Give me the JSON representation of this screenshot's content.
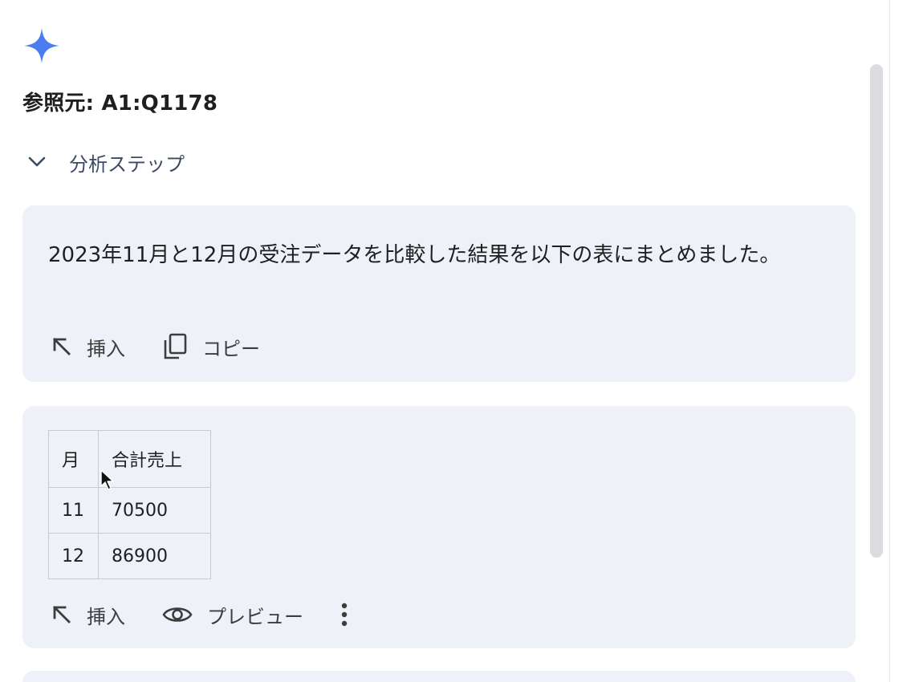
{
  "header": {
    "spark_icon": "gemini-spark-icon",
    "spark_color": "#4b7cf0",
    "source_label": "参照元: A1:Q1178"
  },
  "analysis_steps": {
    "label": "分析ステップ",
    "icon": "chevron-down-icon"
  },
  "summary_card": {
    "text": "2023年11月と12月の受注データを比較した結果を以下の表にまとめました。",
    "actions": [
      {
        "label": "挿入",
        "icon": "insert-arrow-icon"
      },
      {
        "label": "コピー",
        "icon": "copy-icon"
      }
    ]
  },
  "table_card": {
    "columns": [
      "月",
      "合計売上"
    ],
    "rows": [
      [
        "11",
        "70500"
      ],
      [
        "12",
        "86900"
      ]
    ],
    "actions": [
      {
        "label": "挿入",
        "icon": "insert-arrow-icon"
      },
      {
        "label": "プレビュー",
        "icon": "eye-icon"
      },
      {
        "label": "",
        "icon": "more-vert-icon"
      }
    ]
  },
  "colors": {
    "card_bg": "#eef2f8",
    "accent": "#4b7cf0",
    "steps_text": "#3c4a63"
  }
}
